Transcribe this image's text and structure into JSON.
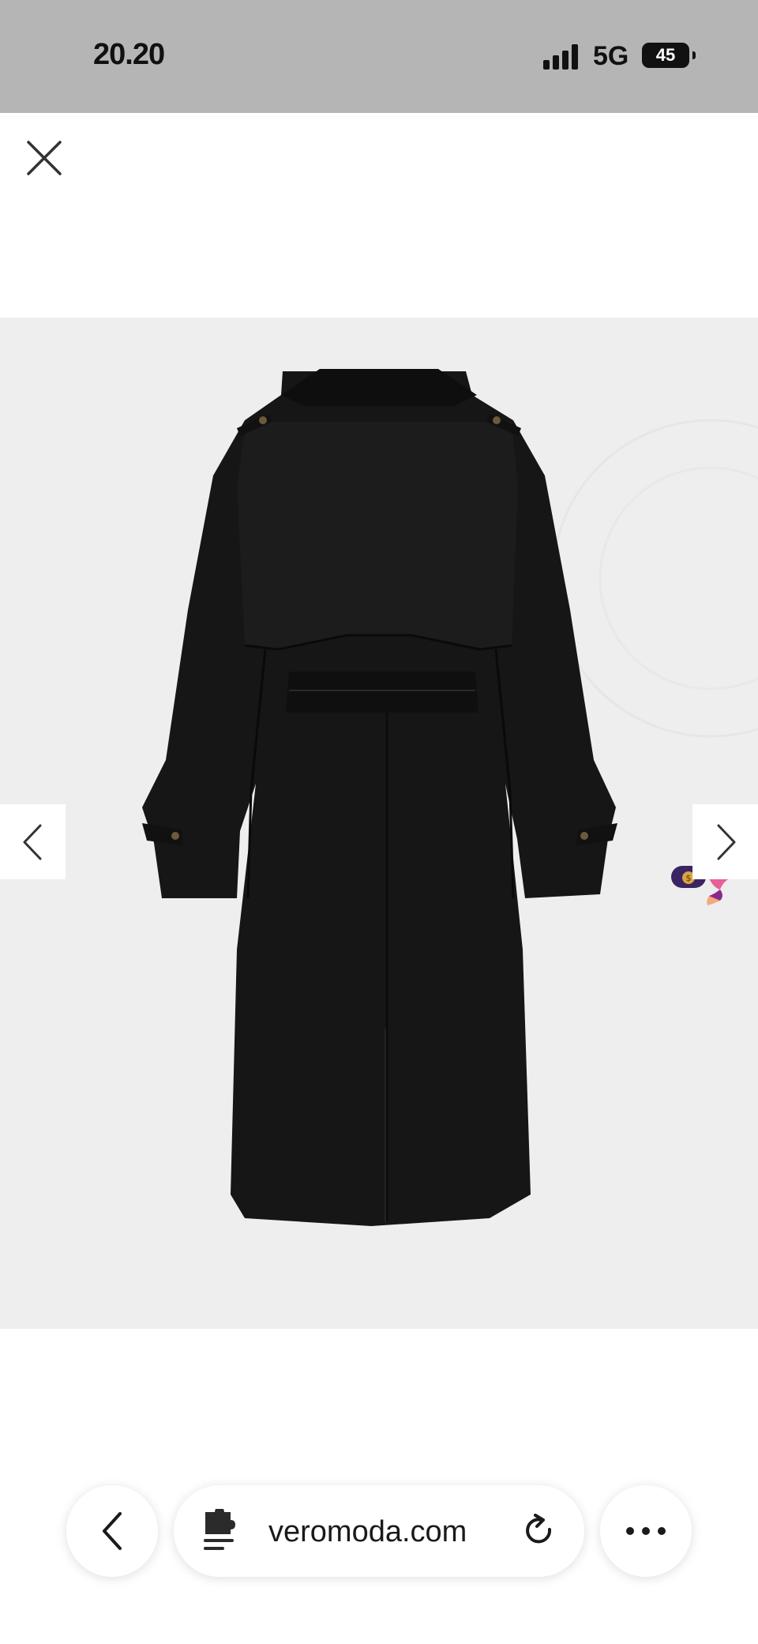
{
  "status_bar": {
    "time": "20.20",
    "network": "5G",
    "battery": "45"
  },
  "gallery": {
    "product_image": "black-trench-coat-back-view",
    "background": "#eeeeee",
    "coat_color": "#161616"
  },
  "browser": {
    "url": "veromoda.com"
  },
  "icons": {
    "close": "close-icon",
    "prev": "chevron-left-icon",
    "next": "chevron-right-icon",
    "back": "back-arrow-icon",
    "extension": "puzzle-page-icon",
    "reload": "reload-icon",
    "more": "more-dots-icon"
  }
}
